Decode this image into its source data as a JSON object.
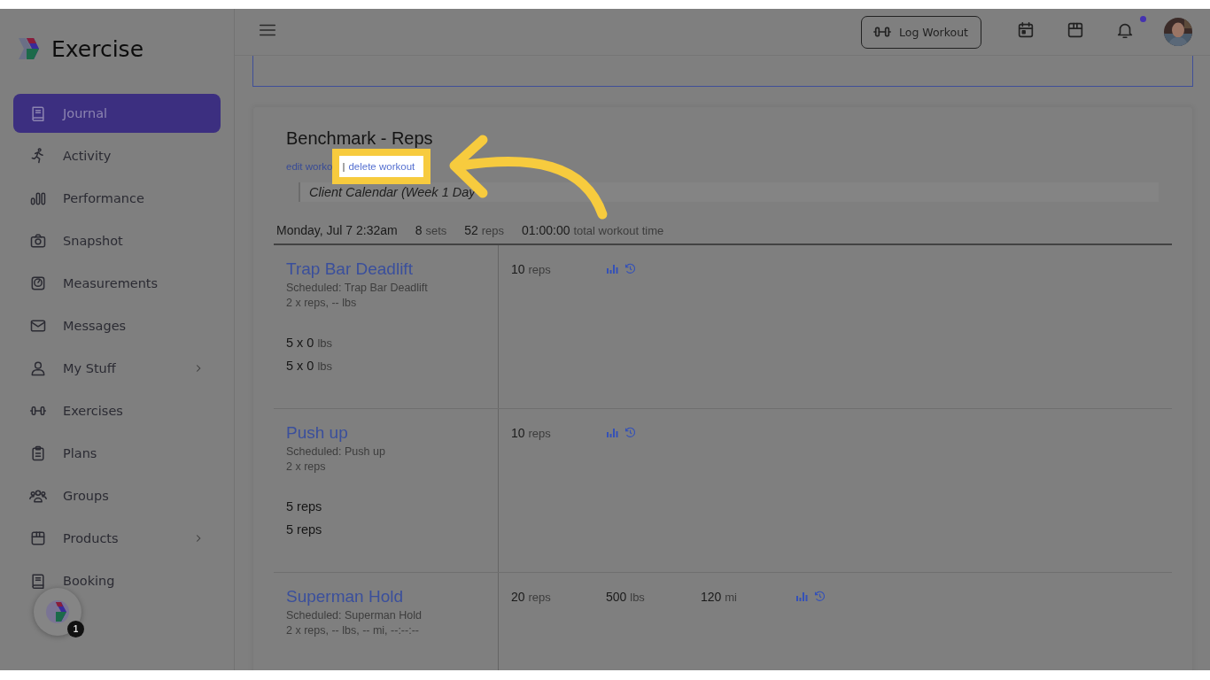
{
  "brand": {
    "name": "Exercise"
  },
  "sidebar": {
    "items": [
      {
        "label": "Journal",
        "selected": true,
        "has_submenu": false
      },
      {
        "label": "Activity",
        "selected": false,
        "has_submenu": false
      },
      {
        "label": "Performance",
        "selected": false,
        "has_submenu": false
      },
      {
        "label": "Snapshot",
        "selected": false,
        "has_submenu": false
      },
      {
        "label": "Measurements",
        "selected": false,
        "has_submenu": false
      },
      {
        "label": "Messages",
        "selected": false,
        "has_submenu": false
      },
      {
        "label": "My Stuff",
        "selected": false,
        "has_submenu": true
      },
      {
        "label": "Exercises",
        "selected": false,
        "has_submenu": false
      },
      {
        "label": "Plans",
        "selected": false,
        "has_submenu": false
      },
      {
        "label": "Groups",
        "selected": false,
        "has_submenu": false
      },
      {
        "label": "Products",
        "selected": false,
        "has_submenu": true
      },
      {
        "label": "Booking",
        "selected": false,
        "has_submenu": false
      }
    ]
  },
  "help_bubble": {
    "badge": "1"
  },
  "header": {
    "log_button": "Log Workout",
    "notification_dot": true
  },
  "workout": {
    "title": "Benchmark - Reps",
    "edit_link": "edit worko",
    "separator": "|",
    "delete_link": "delete workout",
    "source": "Client Calendar (Week 1 Day",
    "stats": [
      {
        "value": "Monday, Jul 7 2:32am"
      },
      {
        "value": "8",
        "unit": "sets"
      },
      {
        "value": "52",
        "unit": "reps"
      },
      {
        "value": "01:00:00",
        "unit": "total workout time"
      }
    ],
    "exercises": [
      {
        "name": "Trap Bar Deadlift",
        "scheduled": "Scheduled: Trap Bar Deadlift",
        "target": "2 x reps, -- lbs",
        "sets": [
          {
            "value": "5 x 0",
            "unit": "lbs"
          },
          {
            "value": "5 x 0",
            "unit": "lbs"
          }
        ],
        "results": [
          {
            "value": "10",
            "unit": "reps"
          }
        ]
      },
      {
        "name": "Push up",
        "scheduled": "Scheduled: Push up",
        "target": "2 x reps",
        "sets": [
          {
            "value": "5 reps"
          },
          {
            "value": "5 reps"
          }
        ],
        "results": [
          {
            "value": "10",
            "unit": "reps"
          }
        ]
      },
      {
        "name": "Superman Hold",
        "scheduled": "Scheduled: Superman Hold",
        "target": "2 x reps, -- lbs, -- mi, --:--:--",
        "results": [
          {
            "value": "20",
            "unit": "reps"
          },
          {
            "value": "500",
            "unit": "lbs"
          },
          {
            "value": "120",
            "unit": "mi"
          }
        ]
      }
    ]
  }
}
